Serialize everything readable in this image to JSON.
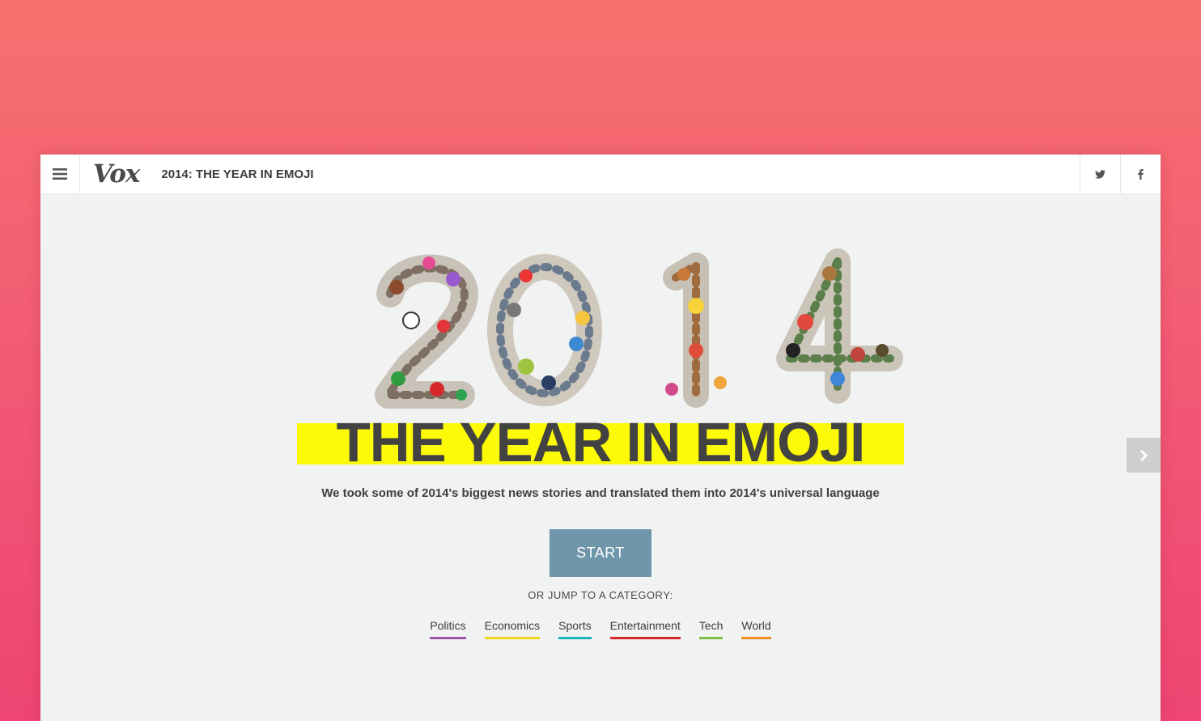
{
  "header": {
    "brand": "Vox",
    "title": "2014: THE YEAR IN EMOJI",
    "menu_icon": "hamburger-icon",
    "share": [
      {
        "name": "twitter",
        "icon": "twitter-icon"
      },
      {
        "name": "facebook",
        "icon": "facebook-icon"
      }
    ]
  },
  "hero": {
    "headline": "THE YEAR IN EMOJI",
    "subtitle": "We took some of 2014's biggest news stories and translated them into 2014's universal language",
    "start_label": "START",
    "jump_label": "OR JUMP TO A CATEGORY:",
    "highlight_color": "#fdfa08"
  },
  "categories": [
    {
      "label": "Politics",
      "color": "#9b59a8"
    },
    {
      "label": "Economics",
      "color": "#f2d41c"
    },
    {
      "label": "Sports",
      "color": "#1bb3b8"
    },
    {
      "label": "Entertainment",
      "color": "#d8272e"
    },
    {
      "label": "Tech",
      "color": "#7ac142"
    },
    {
      "label": "World",
      "color": "#f28c1e"
    }
  ],
  "colors": {
    "start_button": "#6f96aa",
    "page_bg": "#f1f2f2"
  },
  "icons": {
    "next": "chevron-right-icon"
  }
}
